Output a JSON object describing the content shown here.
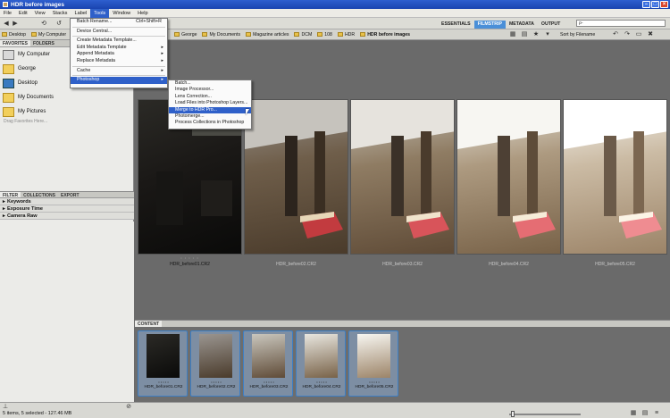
{
  "window": {
    "title": "HDR before images"
  },
  "menubar": [
    "File",
    "Edit",
    "View",
    "Stacks",
    "Label",
    "Tools",
    "Window",
    "Help"
  ],
  "active_menu": "Tools",
  "workspaces": [
    "ESSENTIALS",
    "FILMSTRIP",
    "METADATA",
    "OUTPUT"
  ],
  "active_workspace": "FILMSTRIP",
  "search": {
    "placeholder": "ρ-"
  },
  "path_bar": {
    "left": [
      "Desktop",
      "My Computer"
    ],
    "crumbs": [
      "George",
      "My Documents",
      "Magazine articles",
      "DCM",
      "108",
      "HDR",
      "HDR before images"
    ]
  },
  "sort": {
    "label": "Sort by Filename"
  },
  "favorites_tabs": [
    "FAVORITES",
    "FOLDERS"
  ],
  "favorites": [
    {
      "label": "My Computer",
      "icon": "computer-icon"
    },
    {
      "label": "George",
      "icon": "folder-icon"
    },
    {
      "label": "Desktop",
      "icon": "desktop-icon"
    },
    {
      "label": "My Documents",
      "icon": "documents-icon"
    },
    {
      "label": "My Pictures",
      "icon": "pictures-icon"
    }
  ],
  "drag_hint": "Drag Favorites Here...",
  "filter_tabs": [
    "FILTER",
    "COLLECTIONS",
    "EXPORT"
  ],
  "filters": [
    "Keywords",
    "Exposure Time",
    "Camera Raw"
  ],
  "tools_menu": [
    {
      "label": "Batch Rename...",
      "shortcut": "Ctrl+Shift+R"
    },
    {
      "sep": true
    },
    {
      "label": "Device Central..."
    },
    {
      "sep": true
    },
    {
      "label": "Create Metadata Template..."
    },
    {
      "label": "Edit Metadata Template",
      "submenu": true
    },
    {
      "label": "Append Metadata",
      "submenu": true
    },
    {
      "label": "Replace Metadata",
      "submenu": true
    },
    {
      "sep": true
    },
    {
      "label": "Cache",
      "submenu": true
    },
    {
      "sep": true
    },
    {
      "label": "Photoshop",
      "submenu": true,
      "active": true
    }
  ],
  "photoshop_submenu": [
    "Batch...",
    "Image Processor...",
    "Lens Correction...",
    "Load Files into Photoshop Layers...",
    "Merge to HDR Pro...",
    "Photomerge...",
    "Process Collections in Photoshop"
  ],
  "photoshop_submenu_active": "Merge to HDR Pro...",
  "previews": [
    {
      "label": "HDR_before01.CR2",
      "stars": "• • • • •"
    },
    {
      "label": "HDR_before02.CR2",
      "stars": "• • • • •"
    },
    {
      "label": "HDR_before03.CR2",
      "stars": "• • • • •"
    },
    {
      "label": "HDR_before04.CR2",
      "stars": "• • • • •"
    },
    {
      "label": "HDR_before05.CR2",
      "stars": "• • • • •"
    }
  ],
  "content_tab": "CONTENT",
  "thumbnails": [
    {
      "label": "HDR_before01.CR2",
      "stars": "• • • • •"
    },
    {
      "label": "HDR_before02.CR2",
      "stars": "• • • • •"
    },
    {
      "label": "HDR_before03.CR2",
      "stars": "• • • • •"
    },
    {
      "label": "HDR_before04.CR2",
      "stars": "• • • • •"
    },
    {
      "label": "HDR_before05.CR2",
      "stars": "• • • • •"
    }
  ],
  "status": "5 items, 5 selected - 127.46 MB",
  "colors": {
    "accent": "#2f60c9",
    "workspace_active": "#4a8fd8",
    "panel": "#ebebe8"
  }
}
